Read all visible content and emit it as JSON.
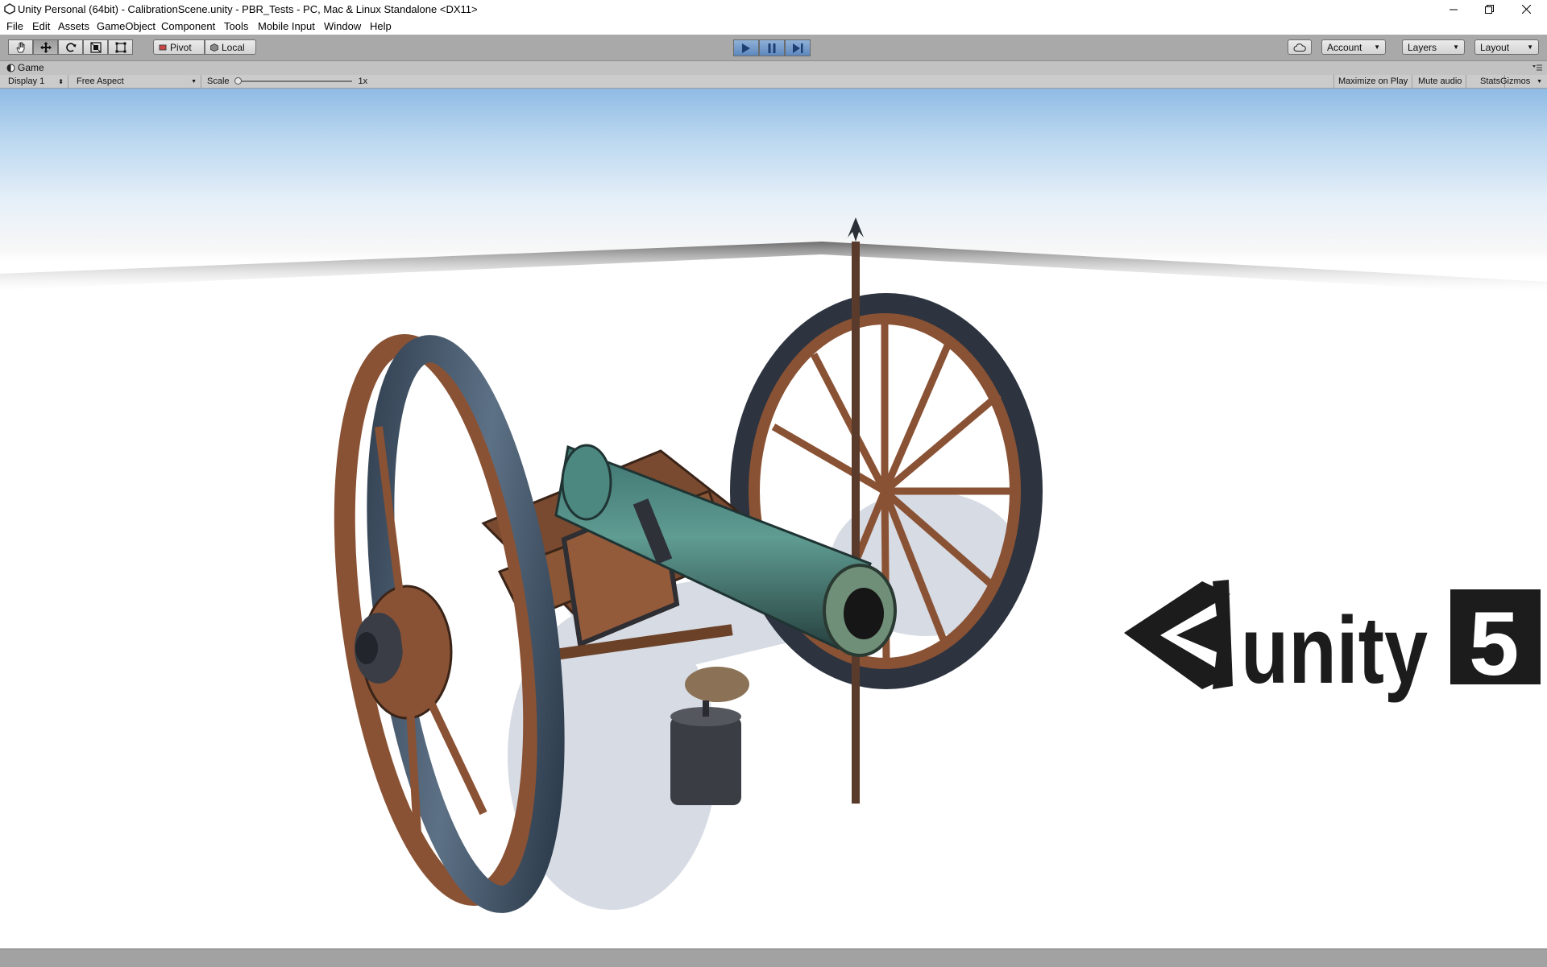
{
  "window": {
    "title": "Unity Personal (64bit) - CalibrationScene.unity - PBR_Tests - PC, Mac & Linux Standalone <DX11>"
  },
  "menu": {
    "items": [
      "File",
      "Edit",
      "Assets",
      "GameObject",
      "Component",
      "Tools",
      "Mobile Input",
      "Window",
      "Help"
    ]
  },
  "toolbar": {
    "tools": [
      "hand-icon",
      "move-icon",
      "rotate-icon",
      "scale-icon",
      "rect-tool-icon"
    ],
    "active_tool": "move-icon",
    "pivot_label": "Pivot",
    "local_label": "Local",
    "play_state": "playing",
    "account_label": "Account",
    "layers_label": "Layers",
    "layout_label": "Layout"
  },
  "game_view": {
    "tab_label": "Game",
    "display_label": "Display 1",
    "aspect_label": "Free Aspect",
    "scale_label": "Scale",
    "scale_value": "1x",
    "scale_level": 0,
    "maximize_label": "Maximize on Play",
    "mute_label": "Mute audio",
    "stats_label": "Stats",
    "gizmos_label": "Gizmos"
  },
  "scene": {
    "logo_word": "unity",
    "logo_number": "5"
  },
  "colors": {
    "toolbar_bg": "#a9a9a9",
    "play_active": "#5d87bd",
    "sky_top": "#8fbbe4",
    "bronze_green": "#4f8c84",
    "wood": "#8a5234"
  }
}
